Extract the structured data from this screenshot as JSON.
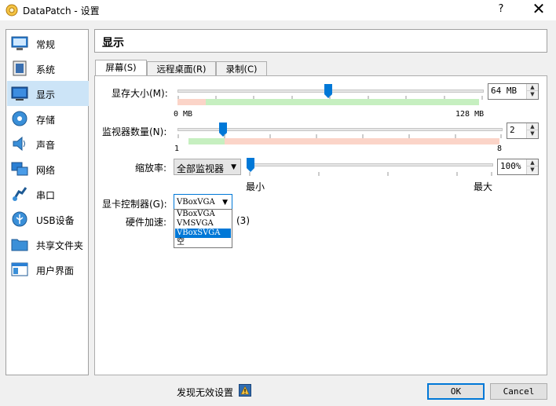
{
  "window": {
    "title": "DataPatch - 设置",
    "help": "?",
    "close": "✕"
  },
  "sidebar": {
    "items": [
      {
        "label": "常规",
        "icon": "general-monitor-icon"
      },
      {
        "label": "系统",
        "icon": "system-chip-icon"
      },
      {
        "label": "显示",
        "icon": "display-monitor-icon",
        "selected": true
      },
      {
        "label": "存储",
        "icon": "storage-disc-icon"
      },
      {
        "label": "声音",
        "icon": "speaker-icon"
      },
      {
        "label": "网络",
        "icon": "network-icon"
      },
      {
        "label": "串口",
        "icon": "serial-port-icon"
      },
      {
        "label": "USB设备",
        "icon": "usb-icon"
      },
      {
        "label": "共享文件夹",
        "icon": "folder-icon"
      },
      {
        "label": "用户界面",
        "icon": "user-interface-icon"
      }
    ]
  },
  "section": {
    "title": "显示"
  },
  "tabs": [
    {
      "label": "屏幕(S)",
      "active": true
    },
    {
      "label": "远程桌面(R)"
    },
    {
      "label": "录制(C)"
    }
  ],
  "screen": {
    "video_memory": {
      "label": "显存大小(M):",
      "min_label": "0 MB",
      "max_label": "128 MB",
      "value": "64 MB",
      "level": 0.5
    },
    "monitors": {
      "label": "监视器数量(N):",
      "min_label": "1",
      "max_label": "8",
      "value": "2",
      "level": 0.143
    },
    "scale": {
      "label": "缩放率:",
      "combo_value": "全部监视器",
      "min_label": "最小",
      "max_label": "最大",
      "value": "100%",
      "level": 0.0
    },
    "graphics_controller": {
      "label": "显卡控制器(G):",
      "selected": "VBoxVGA",
      "options": [
        "VBoxVGA",
        "VMSVGA",
        "VBoxSVGA",
        "空"
      ],
      "highlighted": "VBoxSVGA"
    },
    "acceleration": {
      "label": "硬件加速:",
      "partial_text": "(3)"
    }
  },
  "footer": {
    "invalid_settings": "发现无效设置",
    "warning_icon": "warning-icon",
    "ok": "OK",
    "cancel": "Cancel"
  },
  "colors": {
    "accent": "#0078d7",
    "selection": "#cce4f7",
    "green": "#c6efc0",
    "red": "#fbd4c8"
  }
}
